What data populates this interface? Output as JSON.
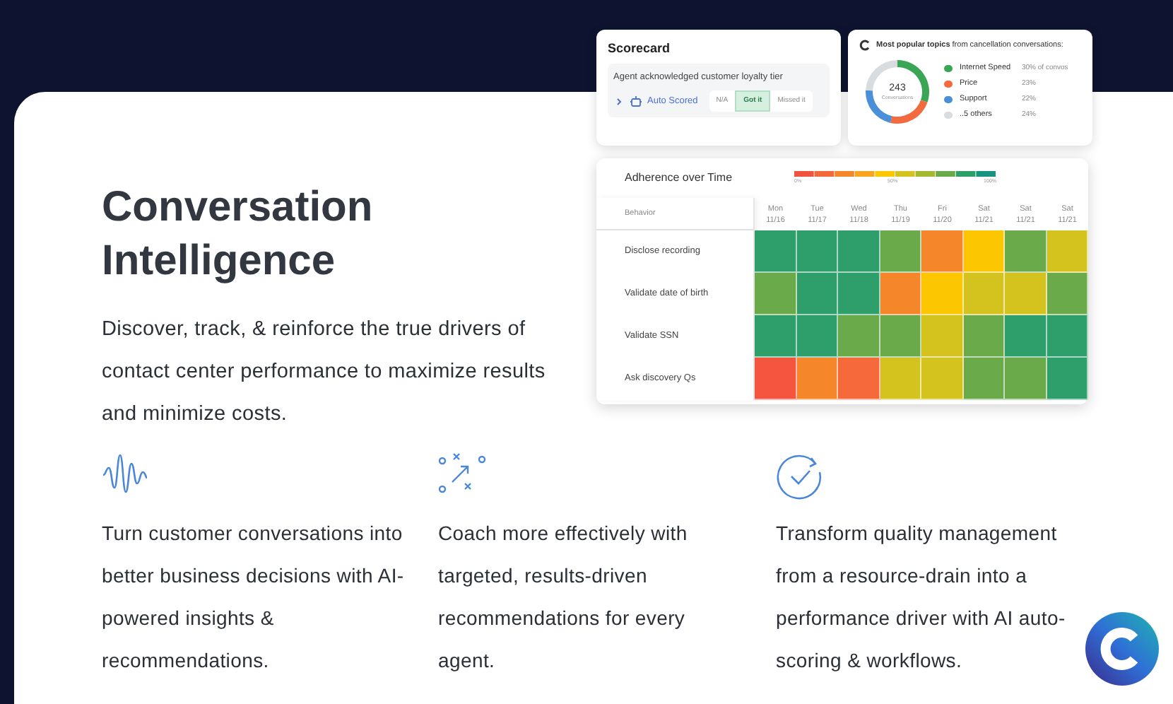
{
  "hero": {
    "title": "Conversation Intelligence",
    "description": "Discover, track, & reinforce the true drivers of contact center performance to maximize results and minimize costs."
  },
  "scorecard": {
    "title": "Scorecard",
    "question": "Agent acknowledged customer loyalty tier",
    "status": "Auto Scored",
    "options": [
      {
        "label": "N/A",
        "selected": false
      },
      {
        "label": "Got it",
        "selected": true
      },
      {
        "label": "Missed it",
        "selected": false
      }
    ]
  },
  "topics": {
    "title": "**Most popular topics** from cancellation conversations:",
    "total": "243",
    "total_label": "Conversations",
    "legend": [
      {
        "value": "30% of convos",
        "color": "#3aa655"
      },
      {
        "value": "23%",
        "color": "#f26a3d"
      },
      {
        "value": "22%",
        "color": "#4a90d9"
      },
      {
        "value": "24%",
        "color": "#d9dcdf"
      }
    ],
    "chart_data": {
      "type": "donut",
      "categories": [
        "Internet Speed",
        "Price",
        "Support",
        "..5 others"
      ],
      "values": [
        30,
        23,
        22,
        24
      ]
    }
  },
  "adherence": {
    "title": "Adherence over Time",
    "scale_labels": [
      "0%",
      "50%",
      "100%"
    ],
    "behavior_header": "Behavior",
    "columns": [
      {
        "day": "Mon",
        "date": "11/16"
      },
      {
        "day": "Tue",
        "date": "11/17"
      },
      {
        "day": "Wed",
        "date": "11/18"
      },
      {
        "day": "Thu",
        "date": "11/19"
      },
      {
        "day": "Fri",
        "date": "11/20"
      },
      {
        "day": "Sat",
        "date": "11/21"
      },
      {
        "day": "Sat",
        "date": "11/21"
      },
      {
        "day": "Sat",
        "date": "11/21"
      }
    ],
    "rows": [
      {
        "behavior": "Disclose recording",
        "cells": [
          {
            "color": "#2e9e6a"
          },
          {
            "color": "#2e9e6a"
          },
          {
            "color": "#2e9e6a"
          },
          {
            "color": "#6aaa4a"
          },
          {
            "color": "#f5862a"
          },
          {
            "color": "#fcc600"
          },
          {
            "color": "#6aaa4a"
          },
          {
            "color": "#d4c21e"
          }
        ]
      },
      {
        "behavior": "Validate date of birth",
        "cells": [
          {
            "color": "#6aaa4a"
          },
          {
            "color": "#2e9e6a"
          },
          {
            "color": "#2e9e6a"
          },
          {
            "color": "#f5862a"
          },
          {
            "color": "#fcc600"
          },
          {
            "color": "#d4c21e"
          },
          {
            "color": "#d4c21e"
          },
          {
            "color": "#6aaa4a"
          }
        ]
      },
      {
        "behavior": "Validate SSN",
        "cells": [
          {
            "color": "#2e9e6a"
          },
          {
            "color": "#2e9e6a"
          },
          {
            "color": "#6aaa4a"
          },
          {
            "color": "#6aaa4a"
          },
          {
            "color": "#d4c21e"
          },
          {
            "color": "#6aaa4a"
          },
          {
            "color": "#2e9e6a"
          },
          {
            "color": "#2e9e6a"
          }
        ]
      },
      {
        "behavior": "Ask discovery Qs",
        "cells": [
          {
            "color": "#f5553f"
          },
          {
            "color": "#f5862a"
          },
          {
            "color": "#f5693a"
          },
          {
            "color": "#d4c21e"
          },
          {
            "color": "#d4c21e"
          },
          {
            "color": "#6aaa4a"
          },
          {
            "color": "#6aaa4a"
          },
          {
            "color": "#2e9e6a"
          }
        ]
      }
    ]
  },
  "features": [
    {
      "kind": "wave",
      "text": "Turn customer conversations into better business decisions with AI-powered insights & recommendations."
    },
    {
      "kind": "play",
      "text": "Coach more effectively with targeted, results-driven recommendations for every agent."
    },
    {
      "kind": "check",
      "text": "Transform quality management from a resource-drain into a performance driver with AI auto-scoring & workflows."
    }
  ]
}
